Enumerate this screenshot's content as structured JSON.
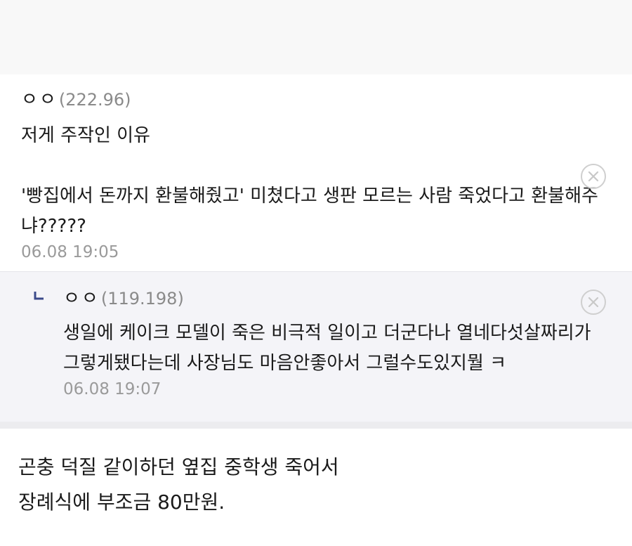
{
  "comment": {
    "author": "ㅇㅇ",
    "ip": "(222.96)",
    "body": "저게 주작인 이유\n\n'빵집에서 돈까지 환불해줬고' 미쳤다고 생판 모르는 사람 죽었다고 환불해주냐?????",
    "date": "06.08 19:05",
    "close_icon": "close-circle-icon"
  },
  "reply": {
    "arrow_icon": "reply-arrow-icon",
    "author": "ㅇㅇ",
    "ip": "(119.198)",
    "body": "생일에 케이크 모델이 죽은 비극적 일이고 더군다나 열네다섯살짜리가 그렇게됐다는데 사장님도 마음안좋아서 그럴수도있지뭘 ㅋ",
    "date": "06.08 19:07",
    "close_icon": "close-circle-icon"
  },
  "post": {
    "body": "곤충 덕질 같이하던 옆집 중학생 죽어서\n장례식에 부조금 80만원."
  }
}
